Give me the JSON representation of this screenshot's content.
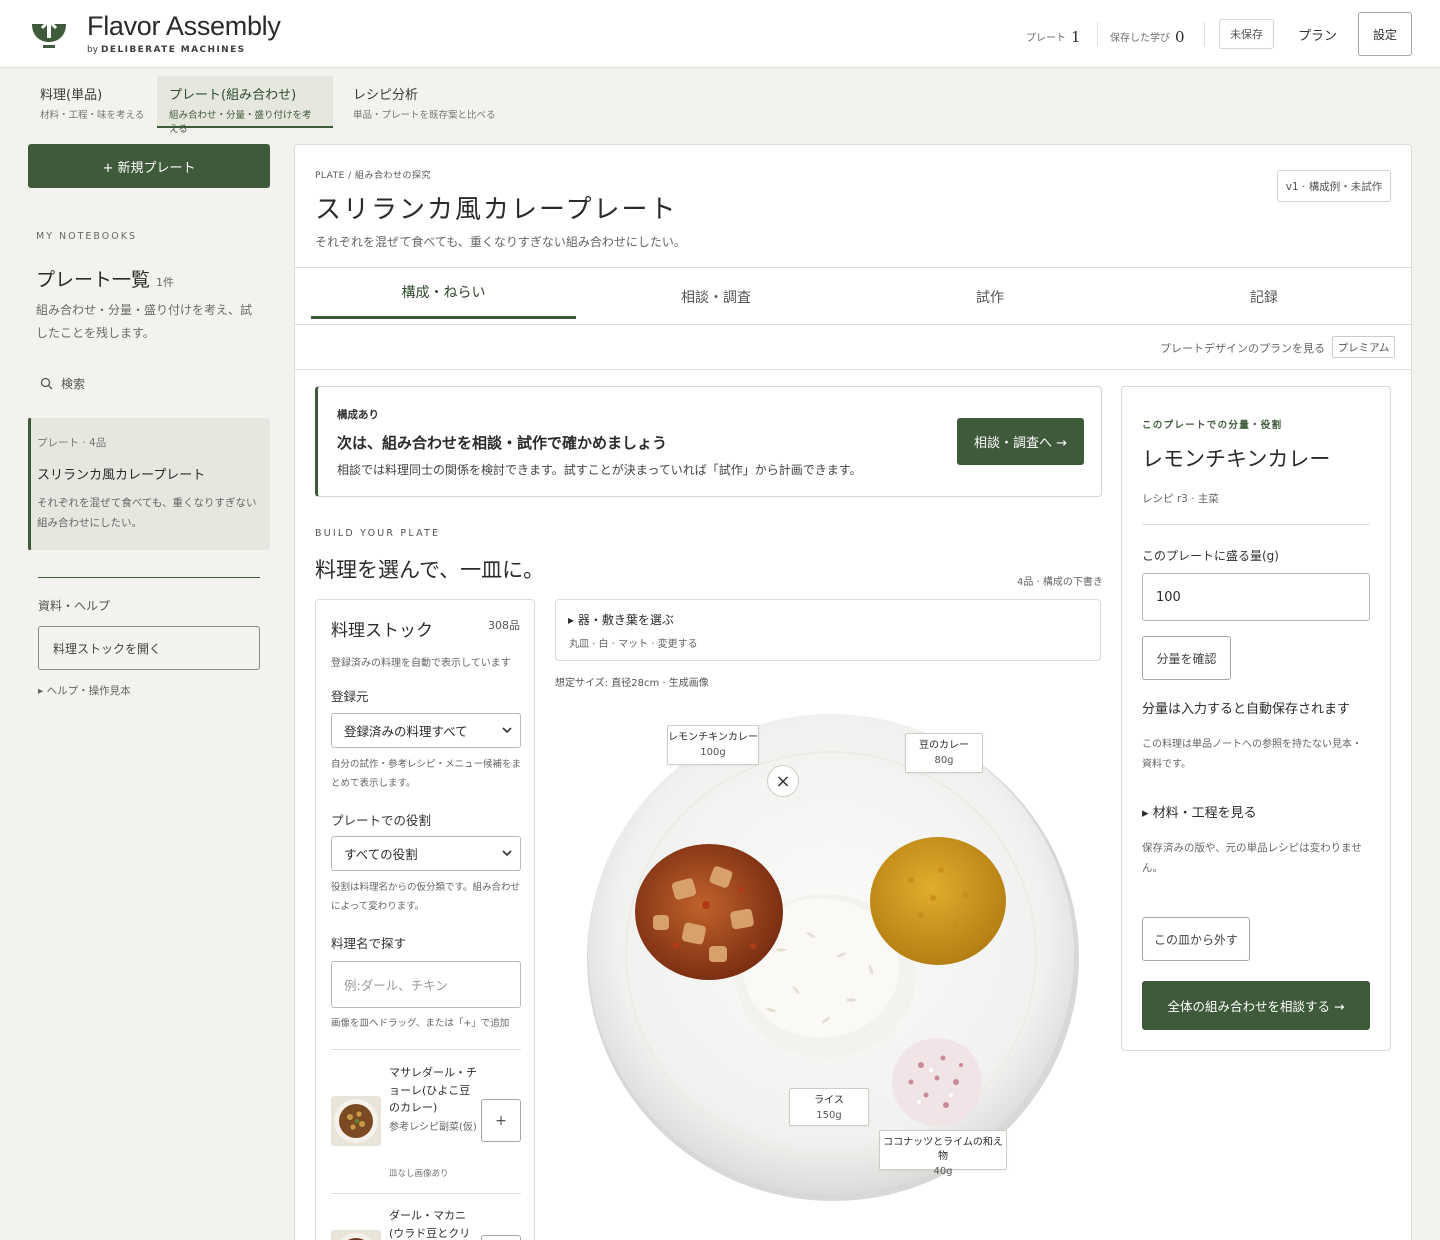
{
  "header": {
    "brand": "Flavor Assembly",
    "brand_by": "by",
    "brand_company": "DELIBERATE MACHINES",
    "plates_label": "プレート",
    "plates_count": "1",
    "learned_label": "保存した学び",
    "learned_count": "0",
    "unsaved": "未保存",
    "plan": "プラン",
    "settings": "設定"
  },
  "mode_tabs": [
    {
      "title": "料理(単品)",
      "sub": "材料・工程・味を考える"
    },
    {
      "title": "プレート(組み合わせ)",
      "sub": "組み合わせ・分量・盛り付けを考える"
    },
    {
      "title": "レシピ分析",
      "sub": "単品・プレートを既存案と比べる"
    }
  ],
  "sidebar": {
    "new_plate": "+ 新規プレート",
    "eyebrow": "MY NOTEBOOKS",
    "title": "プレート一覧",
    "count": "1件",
    "desc": "組み合わせ・分量・盛り付けを考え、試したことを残します。",
    "search": "検索",
    "card": {
      "meta": "プレート · 4品",
      "name": "スリランカ風カレープレート",
      "desc": "それぞれを混ぜて食べても、重くなりすぎない組み合わせにしたい。"
    },
    "resources": "資料・ヘルプ",
    "open_stock": "料理ストックを開く",
    "help": "▸ ヘルプ・操作見本"
  },
  "plate": {
    "crumb": "PLATE / 組み合わせの探究",
    "title": "スリランカ風カレープレート",
    "subtitle": "それぞれを混ぜて食べても、重くなりすぎない組み合わせにしたい。",
    "version": "v1 · 構成例・未試作",
    "tabs": [
      "構成・ねらい",
      "相談・調査",
      "試作",
      "記録"
    ],
    "plan_link": "プレートデザインのプランを見る",
    "premium": "プレミアム"
  },
  "notice": {
    "eyebrow": "構成あり",
    "heading": "次は、組み合わせを相談・試作で確かめましょう",
    "body": "相談では料理同士の関係を検討できます。試すことが決まっていれば「試作」から計画できます。",
    "button": "相談・調査へ →"
  },
  "build": {
    "eyebrow": "BUILD YOUR PLATE",
    "heading": "料理を選んで、一皿に。",
    "meta": "4品 · 構成の下書き"
  },
  "stock": {
    "title": "料理ストック",
    "count": "308品",
    "note": "登録済みの料理を自動で表示しています",
    "source_label": "登録元",
    "source_value": "登録済みの料理すべて",
    "source_help": "自分の試作・参考レシピ・メニュー候補をまとめて表示します。",
    "role_label": "プレートでの役割",
    "role_value": "すべての役割",
    "role_help": "役割は料理名からの仮分類です。組み合わせによって変わります。",
    "search_label": "料理名で探す",
    "search_placeholder": "例:ダール、チキン",
    "drag_help": "画像を皿へドラッグ、または「+」で追加",
    "items": [
      {
        "name": "マサレダール・チョーレ(ひよこ豆のカレー)",
        "tag": "参考レシピ副菜(仮)",
        "sub": "皿なし画像あり",
        "add": "+"
      },
      {
        "name": "ダール・マカニ(ウラド豆とクリーム)",
        "tag": "",
        "sub": "",
        "add": "+"
      }
    ]
  },
  "vessel": {
    "heading": "▸ 器・敷き葉を選ぶ",
    "sub": "丸皿 · 白 · マット · 変更する",
    "assumed": "想定サイズ: 直径28cm · 生成画像"
  },
  "plate_items": [
    {
      "name": "レモンチキンカレー",
      "grams": "100g"
    },
    {
      "name": "豆のカレー",
      "grams": "80g"
    },
    {
      "name": "ライス",
      "grams": "150g"
    },
    {
      "name": "ココナッツとライムの和え物",
      "grams": "40g"
    }
  ],
  "plate_remove": "×",
  "detail": {
    "eyebrow": "このプレートでの分量・役割",
    "name": "レモンチキンカレー",
    "recipe": "レシピ r3 · 主菜",
    "qty_label": "このプレートに盛る量(g)",
    "qty_value": "100",
    "check": "分量を確認",
    "autosave": "分量は入力すると自動保存されます",
    "reference": "この料理は単品ノートへの参照を持たない見本・資料です。",
    "process": "▸ 材料・工程を見る",
    "saved": "保存済みの版や、元の単品レシピは変わりません。",
    "remove": "この皿から外す",
    "consult_all": "全体の組み合わせを相談する →"
  },
  "colors": {
    "accent": "#3f5a3a",
    "background": "#f3f2ee",
    "curry_orange": "#b8541f",
    "dal_yellow": "#d49a1e"
  }
}
